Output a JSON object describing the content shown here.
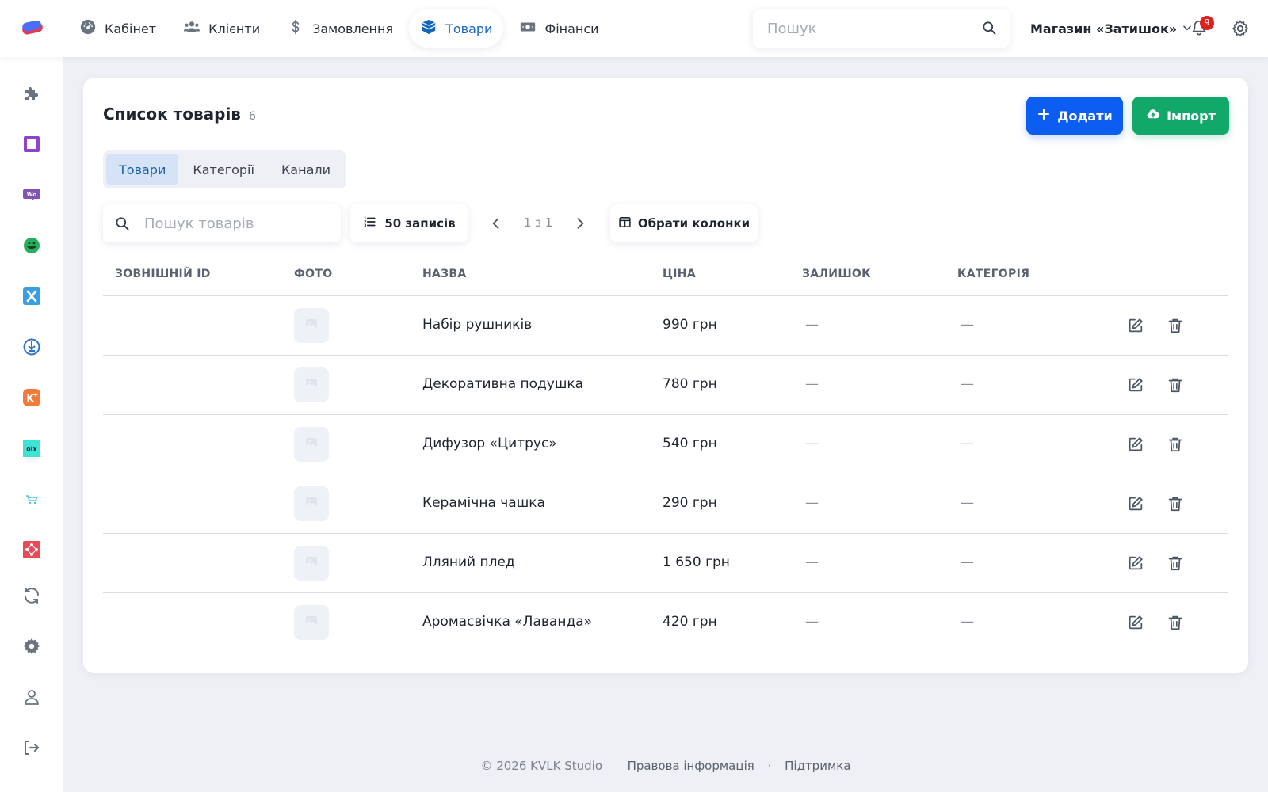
{
  "nav": {
    "items": [
      {
        "label": "Кабінет",
        "icon": "dashboard-gauge-icon"
      },
      {
        "label": "Клієнти",
        "icon": "users-icon"
      },
      {
        "label": "Замовлення",
        "icon": "dollar-icon"
      },
      {
        "label": "Товари",
        "icon": "box-icon",
        "active": true
      },
      {
        "label": "Фінанси",
        "icon": "money-icon"
      }
    ]
  },
  "header": {
    "search_placeholder": "Пошук",
    "store_name": "Магазин «Затишок»",
    "notifications_count": "9"
  },
  "sidebar": {
    "icons": [
      "puzzle-icon",
      "square-app-icon",
      "woo-icon",
      "green-app-icon",
      "x-app-icon",
      "download-app-icon",
      "k-app-icon",
      "olx-icon",
      "cart-icon",
      "network-app-icon",
      "sync-icon",
      "settings-icon",
      "user-icon",
      "logout-icon"
    ]
  },
  "page": {
    "title": "Список товарів",
    "count": "6",
    "add_label": "Додати",
    "import_label": "Імпорт"
  },
  "tabs": [
    {
      "label": "Товари",
      "active": true
    },
    {
      "label": "Категорії"
    },
    {
      "label": "Канали"
    }
  ],
  "toolbar": {
    "search_placeholder": "Пошук товарів",
    "per_page_label": "50 записів",
    "pager_text": "1 з 1",
    "columns_label": "Обрати колонки"
  },
  "table": {
    "headers": [
      "ЗОВНІШНІЙ ID",
      "ФОТО",
      "НАЗВА",
      "ЦІНА",
      "ЗАЛИШОК",
      "КАТЕГОРІЯ"
    ],
    "rows": [
      {
        "external_id": "",
        "name": "Набір рушників",
        "price": "990 грн",
        "stock": "—",
        "category": "—"
      },
      {
        "external_id": "",
        "name": "Декоративна подушка",
        "price": "780 грн",
        "stock": "—",
        "category": "—"
      },
      {
        "external_id": "",
        "name": "Дифузор «Цитрус»",
        "price": "540 грн",
        "stock": "—",
        "category": "—"
      },
      {
        "external_id": "",
        "name": "Керамічна чашка",
        "price": "290 грн",
        "stock": "—",
        "category": "—"
      },
      {
        "external_id": "",
        "name": "Лляний плед",
        "price": "1 650 грн",
        "stock": "—",
        "category": "—"
      },
      {
        "external_id": "",
        "name": "Аромасвічка «Лаванда»",
        "price": "420 грн",
        "stock": "—",
        "category": "—"
      }
    ]
  },
  "footer": {
    "copyright": "© 2026 KVLK Studio",
    "legal_link": "Правова інформація",
    "separator": "·",
    "support_link": "Підтримка"
  },
  "colors": {
    "accent_blue": "#0b5ef0",
    "accent_green": "#12a86a",
    "active_tab_bg": "#d6e3f6",
    "badge_red": "#e0201d"
  }
}
